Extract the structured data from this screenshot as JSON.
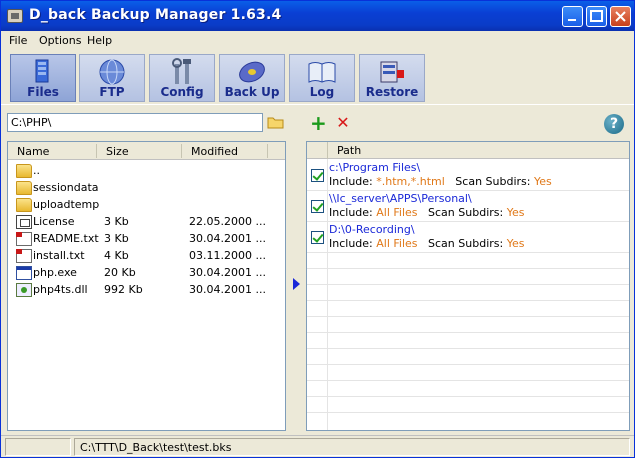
{
  "window": {
    "title": "D_back Backup Manager 1.63.4"
  },
  "menu": [
    {
      "label": "File"
    },
    {
      "label": "Options"
    },
    {
      "label": "Help"
    }
  ],
  "toolbar": [
    {
      "label": "Files",
      "icon": "files-icon",
      "active": true
    },
    {
      "label": "FTP",
      "icon": "ftp-globe-icon",
      "active": false
    },
    {
      "label": "Config",
      "icon": "config-tools-icon",
      "active": false
    },
    {
      "label": "Back Up",
      "icon": "backup-disk-icon",
      "active": false
    },
    {
      "label": "Log",
      "icon": "log-book-icon",
      "active": false
    },
    {
      "label": "Restore",
      "icon": "restore-icon",
      "active": false
    }
  ],
  "left": {
    "path_value": "C:\\PHP\\",
    "columns": {
      "name": "Name",
      "size": "Size",
      "modified": "Modified"
    },
    "files": [
      {
        "name": "..",
        "size": "",
        "modified": "",
        "type": "folder"
      },
      {
        "name": "sessiondata",
        "size": "",
        "modified": "",
        "type": "folder"
      },
      {
        "name": "uploadtemp",
        "size": "",
        "modified": "",
        "type": "folder"
      },
      {
        "name": "License",
        "size": "3 Kb",
        "modified": "22.05.2000 ...",
        "type": "license"
      },
      {
        "name": "README.txt",
        "size": "3 Kb",
        "modified": "30.04.2001 ...",
        "type": "doc-red"
      },
      {
        "name": "install.txt",
        "size": "4 Kb",
        "modified": "03.11.2000 ...",
        "type": "doc-red"
      },
      {
        "name": "php.exe",
        "size": "20 Kb",
        "modified": "30.04.2001 ...",
        "type": "exe"
      },
      {
        "name": "php4ts.dll",
        "size": "992 Kb",
        "modified": "30.04.2001 ...",
        "type": "dll"
      }
    ]
  },
  "right": {
    "add_label": "+",
    "delete_label": "✕",
    "help_label": "?",
    "path_header": "Path",
    "include_label": "Include:",
    "subdirs_label": "Scan Subdirs:",
    "targets": [
      {
        "path": "c:\\Program Files\\",
        "include": "*.htm,*.html",
        "subdirs": "Yes",
        "checked": true
      },
      {
        "path": "\\\\Ic_server\\APPS\\Personal\\",
        "include": "All Files",
        "subdirs": "Yes",
        "checked": true
      },
      {
        "path": "D:\\0-Recording\\",
        "include": "All Files",
        "subdirs": "Yes",
        "checked": true
      }
    ]
  },
  "status": {
    "file": "C:\\TTT\\D_Back\\test\\test.bks"
  },
  "colors": {
    "accent_orange": "#e07818",
    "path_blue": "#1a28d8",
    "title_blue": "#0a3fd4"
  }
}
